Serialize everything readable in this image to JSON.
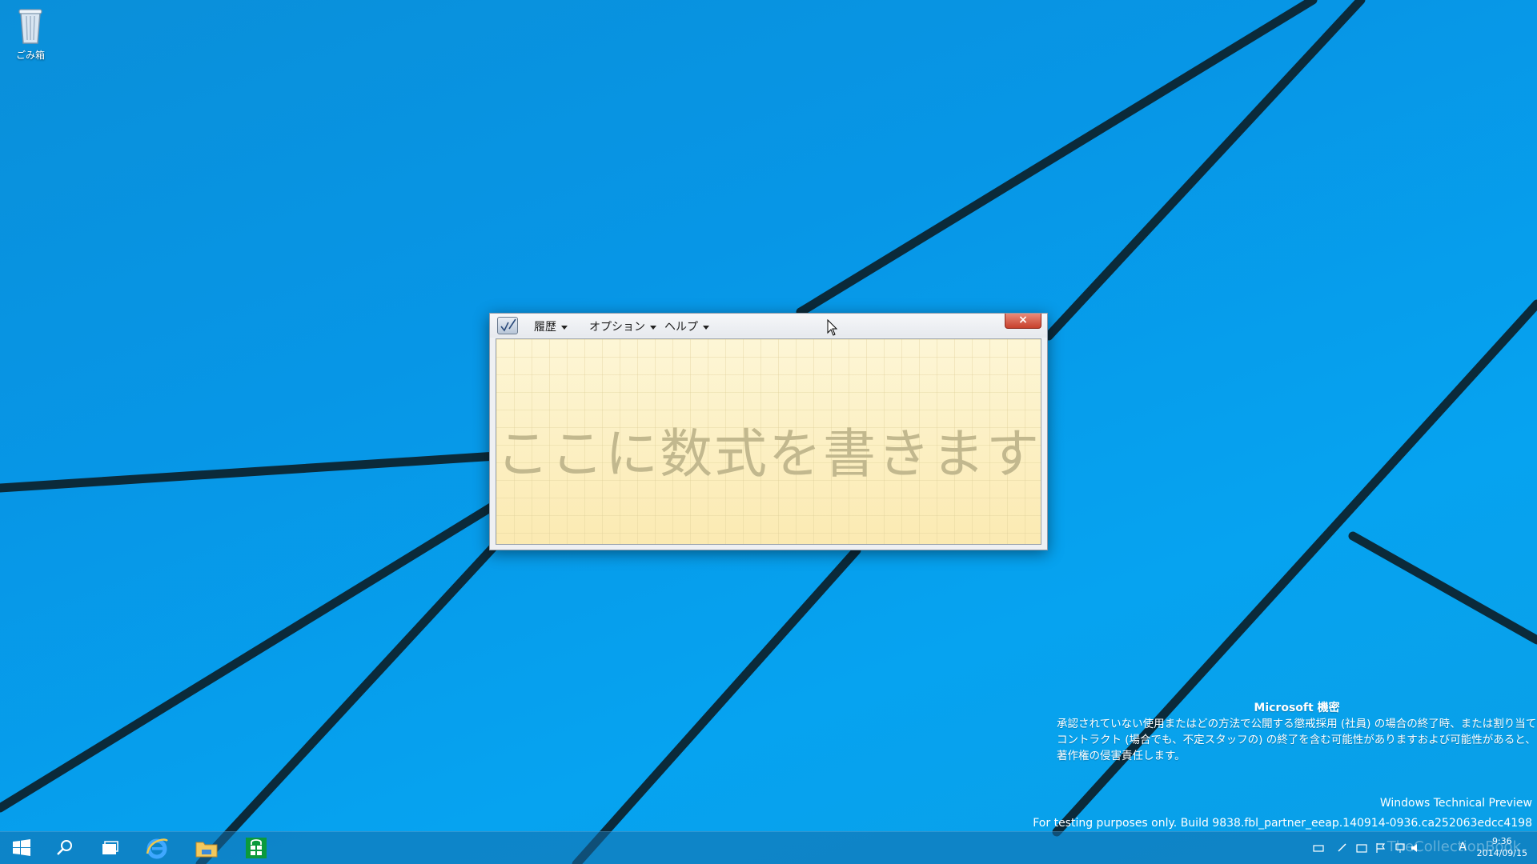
{
  "desktop": {
    "recycle_bin_label": "ごみ箱"
  },
  "window": {
    "menus": [
      {
        "label": "履歴"
      },
      {
        "label": "オプション"
      },
      {
        "label": "ヘルプ"
      }
    ],
    "close_label": "×",
    "writing_prompt": "ここに数式を書きます"
  },
  "watermark": {
    "title": "Microsoft 機密",
    "body": "承認されていない使用またはどの方法で公開する懲戒採用 (社員) の場合の終了時、または割り当てコントラクト (場合でも、不定スタッフの) の終了を含む可能性がありますおよび可能性があると、著作権の侵害責任します。",
    "edition": "Windows Technical Preview",
    "build": "For testing purposes only. Build 9838.fbl_partner_eeap.140914-0936.ca252063edcc4198"
  },
  "taskbar": {
    "icons": [
      "start-icon",
      "search-icon",
      "task-view-icon",
      "internet-explorer-icon",
      "file-explorer-icon",
      "store-icon"
    ],
    "ime": "A",
    "watermark_logo": "TheCollectionBook",
    "time": "9:36",
    "date": "2014/09/15"
  },
  "colors": {
    "desktop_blue": "#0796e6",
    "close_red": "#c7402c",
    "writing_pad": "#fdf3c8"
  }
}
